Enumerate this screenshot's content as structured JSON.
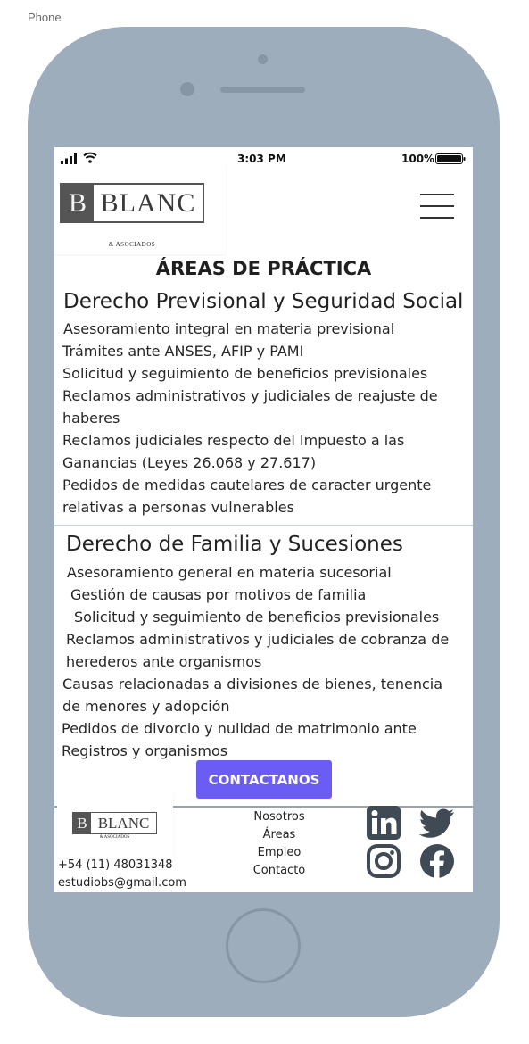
{
  "frame": {
    "label": "Phone"
  },
  "status_bar": {
    "time": "3:03 PM",
    "battery": "100%"
  },
  "header": {
    "logo_letter": "B",
    "logo_name": "BLANC",
    "logo_sub": "& ASOCIADOS",
    "menu_icon": "hamburger-menu-icon"
  },
  "main": {
    "title": "ÁREAS DE PRÁCTICA",
    "sections": [
      {
        "title": "Derecho Previsional y Seguridad Social",
        "items": [
          "Asesoramiento integral en materia previsional",
          "Trámites ante ANSES, AFIP y PAMI",
          "Solicitud y seguimiento de beneficios previsionales",
          "Reclamos administrativos y judiciales de reajuste de",
          "haberes",
          "Reclamos judiciales respecto del Impuesto a las",
          "Ganancias (Leyes 26.068 y 27.617)",
          "Pedidos de medidas cautelares de caracter urgente",
          "relativas a personas vulnerables"
        ]
      },
      {
        "title": "Derecho de Familia y Sucesiones",
        "items": [
          "Asesoramiento general en materia sucesorial",
          "Gestión de causas por motivos de familia",
          "Solicitud y seguimiento de beneficios previsionales",
          "Reclamos administrativos y judiciales de cobranza de",
          "herederos ante organismos",
          "Causas relacionadas a divisiones de bienes, tenencia",
          "de menores y adopción",
          "Pedidos de divorcio y nulidad de matrimonio ante",
          "Registros y organismos"
        ]
      }
    ],
    "cta_label": "CONTACTANOS"
  },
  "footer": {
    "logo_letter": "B",
    "logo_name": "BLANC",
    "logo_sub": "& ASOCIADOS",
    "phone": "+54 (11) 48031348",
    "email": "estudiobs@gmail.com",
    "nav": [
      "Nosotros",
      "Áreas",
      "Empleo",
      "Contacto"
    ],
    "social_icons": [
      "linkedin-icon",
      "twitter-icon",
      "instagram-icon",
      "facebook-icon"
    ]
  },
  "colors": {
    "phone_body": "#9eadbb",
    "accent": "#6a5cf5",
    "text": "#222222",
    "icon": "#3f4a54"
  }
}
